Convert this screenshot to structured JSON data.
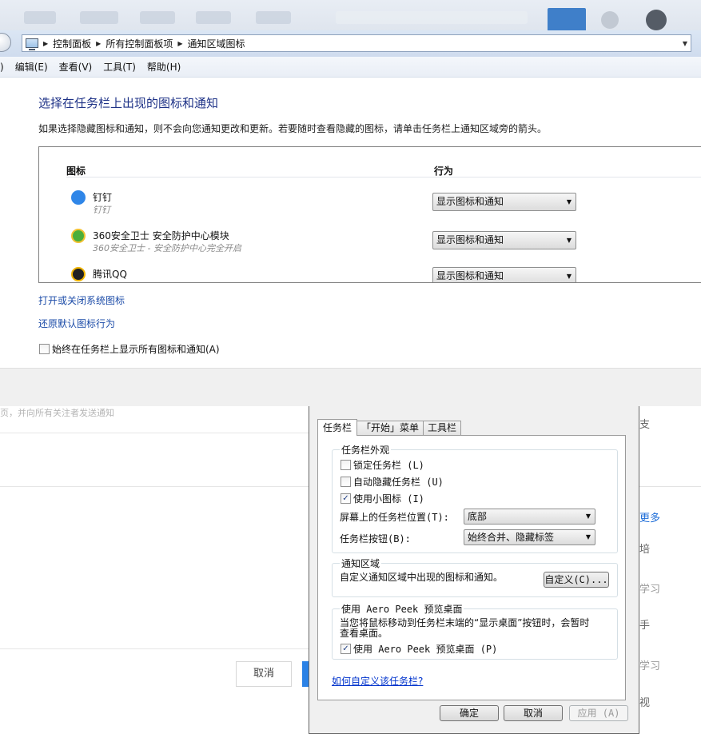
{
  "explorer": {
    "breadcrumbs": [
      "控制面板",
      "所有控制面板项",
      "通知区域图标"
    ],
    "menu": [
      ")",
      "编辑(E)",
      "查看(V)",
      "工具(T)",
      "帮助(H)"
    ]
  },
  "panel": {
    "title": "选择在任务栏上出现的图标和通知",
    "description": "如果选择隐藏图标和通知，则不会向您通知更改和更新。若要随时查看隐藏的图标，请单击任务栏上通知区域旁的箭头。",
    "columns": {
      "icon": "图标",
      "behavior": "行为"
    },
    "rows": [
      {
        "name": "钉钉",
        "sub": "钉钉",
        "behavior": "显示图标和通知",
        "color": "#2f86e8"
      },
      {
        "name": "360安全卫士 安全防护中心模块",
        "sub": "360安全卫士 - 安全防护中心完全开启",
        "behavior": "显示图标和通知",
        "color": "#4cae3a"
      },
      {
        "name": "腾讯QQ",
        "sub": "",
        "behavior": "显示图标和通知",
        "color": "#222222"
      }
    ],
    "link_system_icons": "打开或关闭系统图标",
    "link_restore": "还原默认图标行为",
    "always_show_label": "始终在任务栏上显示所有图标和通知(A)",
    "always_show_checked": false
  },
  "background": {
    "hint": "页，并向所有关注者发送通知",
    "cancel": "取消",
    "side": [
      "支",
      "更多",
      "培",
      "学习",
      "手",
      "学习",
      "视"
    ]
  },
  "dialog": {
    "tabs": [
      "任务栏",
      "「开始」菜单",
      "工具栏"
    ],
    "appearance_title": "任务栏外观",
    "lock_label": "锁定任务栏 (L)",
    "lock_checked": false,
    "autohide_label": "自动隐藏任务栏 (U)",
    "autohide_checked": false,
    "small_icons_label": "使用小图标 (I)",
    "small_icons_checked": true,
    "position_label": "屏幕上的任务栏位置(T):",
    "position_value": "底部",
    "buttons_label": "任务栏按钮(B):",
    "buttons_value": "始终合并、隐藏标签",
    "notify_title": "通知区域",
    "notify_desc": "自定义通知区域中出现的图标和通知。",
    "customize_btn": "自定义(C)...",
    "peek_title": "使用 Aero Peek 预览桌面",
    "peek_desc_1": "当您将鼠标移动到任务栏末端的“显示桌面”按钮时，会暂时",
    "peek_desc_2": "查看桌面。",
    "peek_label": "使用 Aero Peek 预览桌面 (P)",
    "peek_checked": true,
    "help_link": "如何自定义该任务栏?",
    "ok": "确定",
    "cancel": "取消",
    "apply": "应用 (A)"
  }
}
